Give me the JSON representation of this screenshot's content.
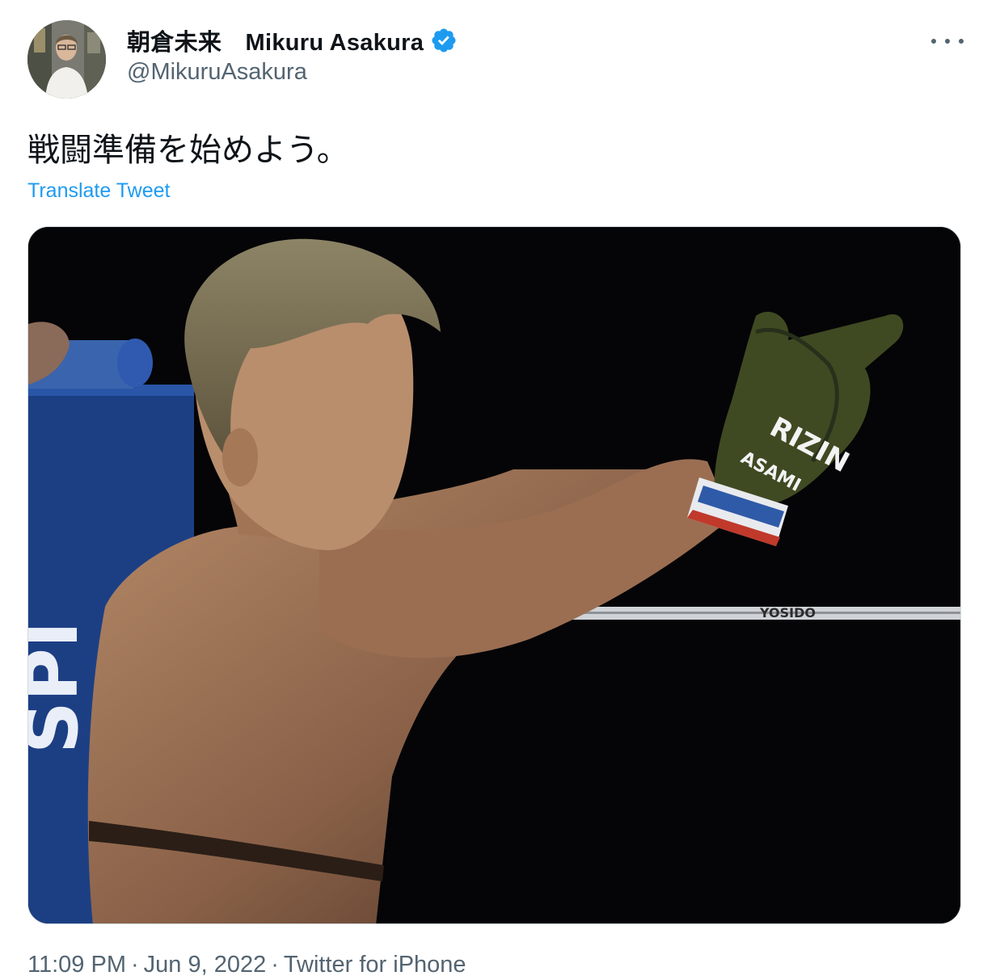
{
  "user": {
    "display_name": "朝倉未来　Mikuru Asakura",
    "handle": "@MikuruAsakura",
    "verified_icon": "verified-badge-icon",
    "avatar_icon": "profile-avatar"
  },
  "tweet": {
    "text": "戦闘準備を始めよう。",
    "translate_label": "Translate Tweet",
    "more_icon": "more-options-icon",
    "media": {
      "description_icon": "fighter-photo",
      "glove_text": "RIZIN",
      "glove_text_2": "ASAMI",
      "rope_text": "YOSIDO"
    }
  },
  "meta": {
    "time": "11:09 PM",
    "separator": "·",
    "date": "Jun 9, 2022",
    "source": "Twitter for iPhone"
  },
  "colors": {
    "link": "#1d9bf0",
    "secondary_text": "#536471",
    "primary_text": "#0f1419"
  }
}
